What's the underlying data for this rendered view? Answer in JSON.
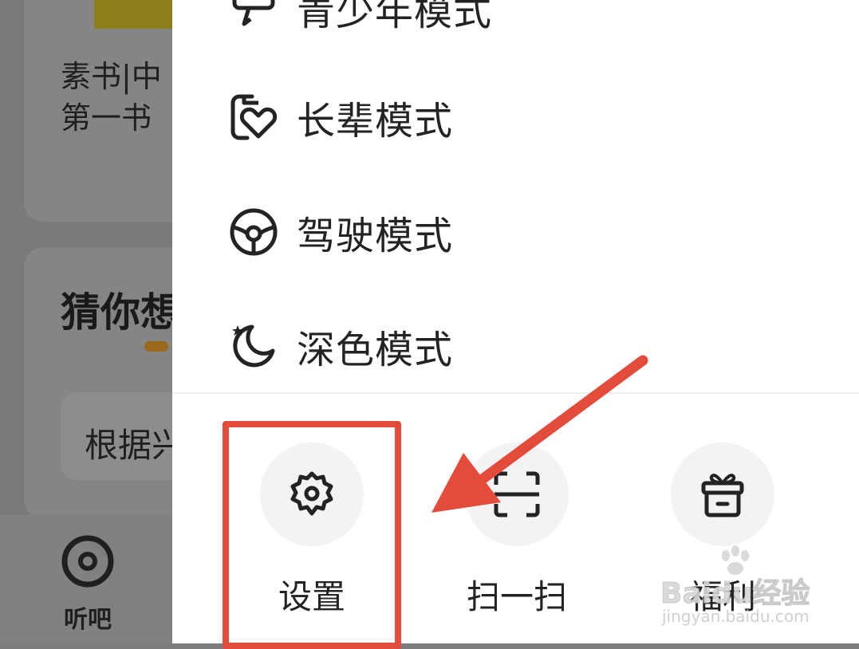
{
  "background_app": {
    "book_title": "素书|中\n第一书",
    "section_title": "猜你想",
    "chip_text": "根据兴",
    "tab_label": "听吧",
    "tab_icon": "music-disc-icon"
  },
  "menu": {
    "items": [
      {
        "label": "青少年模式",
        "icon": "teen-mode-icon"
      },
      {
        "label": "长辈模式",
        "icon": "elder-heart-icon"
      },
      {
        "label": "驾驶模式",
        "icon": "steering-wheel-icon"
      },
      {
        "label": "深色模式",
        "icon": "moon-star-icon"
      }
    ]
  },
  "quick_actions": [
    {
      "label": "设置",
      "icon": "gear-icon"
    },
    {
      "label": "扫一扫",
      "icon": "scan-icon"
    },
    {
      "label": "福利",
      "icon": "gift-icon"
    }
  ],
  "annotation": {
    "color": "#e34b3a"
  },
  "watermark": {
    "main": "Baidu经验",
    "sub": "jingyan.baidu.com"
  }
}
